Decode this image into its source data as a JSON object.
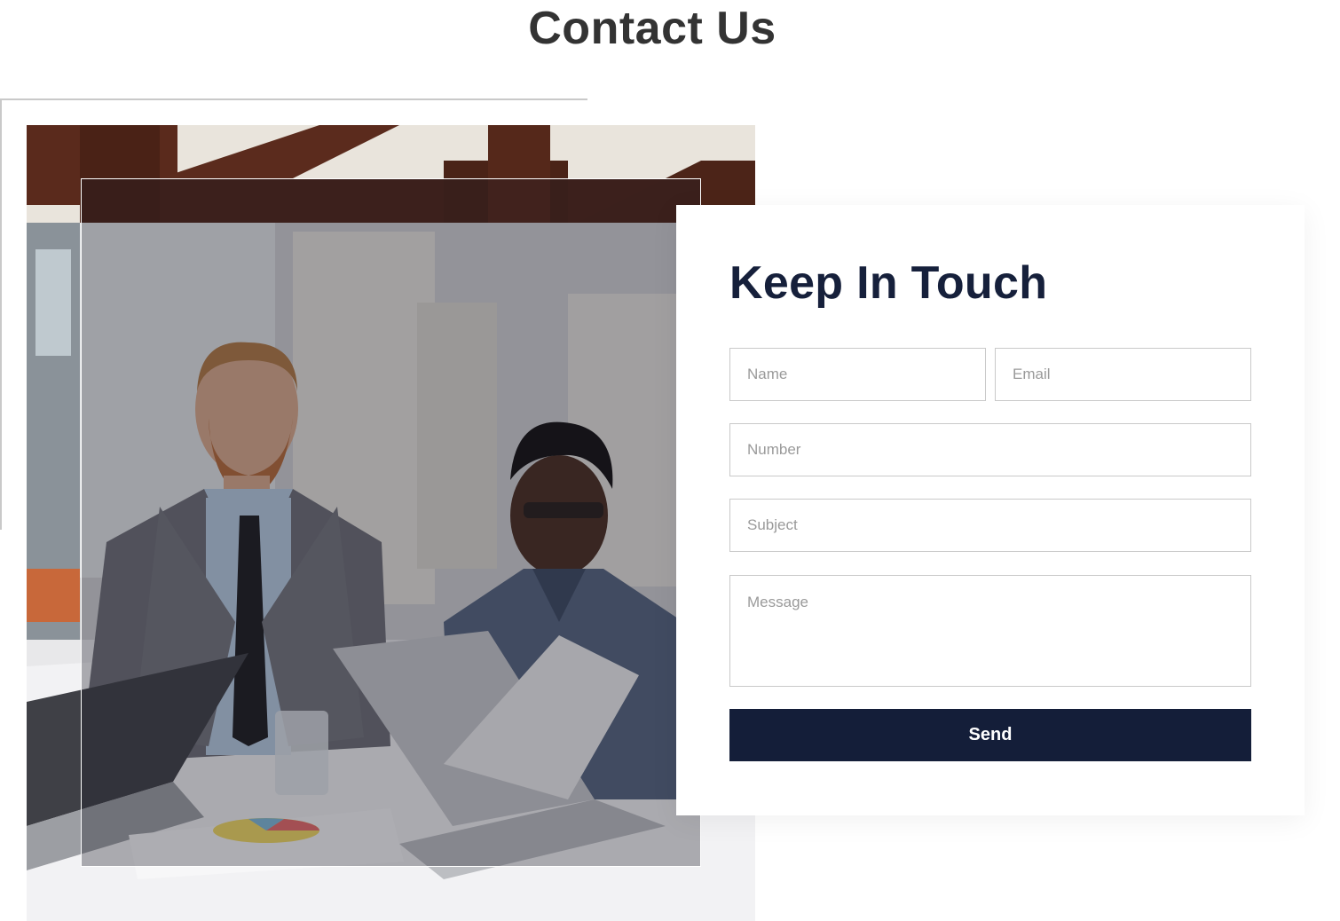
{
  "page": {
    "title": "Contact Us"
  },
  "image": {
    "description_icon": "office-meeting-photo"
  },
  "form": {
    "heading": "Keep In Touch",
    "name_placeholder": "Name",
    "email_placeholder": "Email",
    "number_placeholder": "Number",
    "subject_placeholder": "Subject",
    "message_placeholder": "Message",
    "send_label": "Send"
  },
  "colors": {
    "title": "#333333",
    "heading": "#16203b",
    "button": "#141e39",
    "field_border": "#c9c9c9"
  }
}
